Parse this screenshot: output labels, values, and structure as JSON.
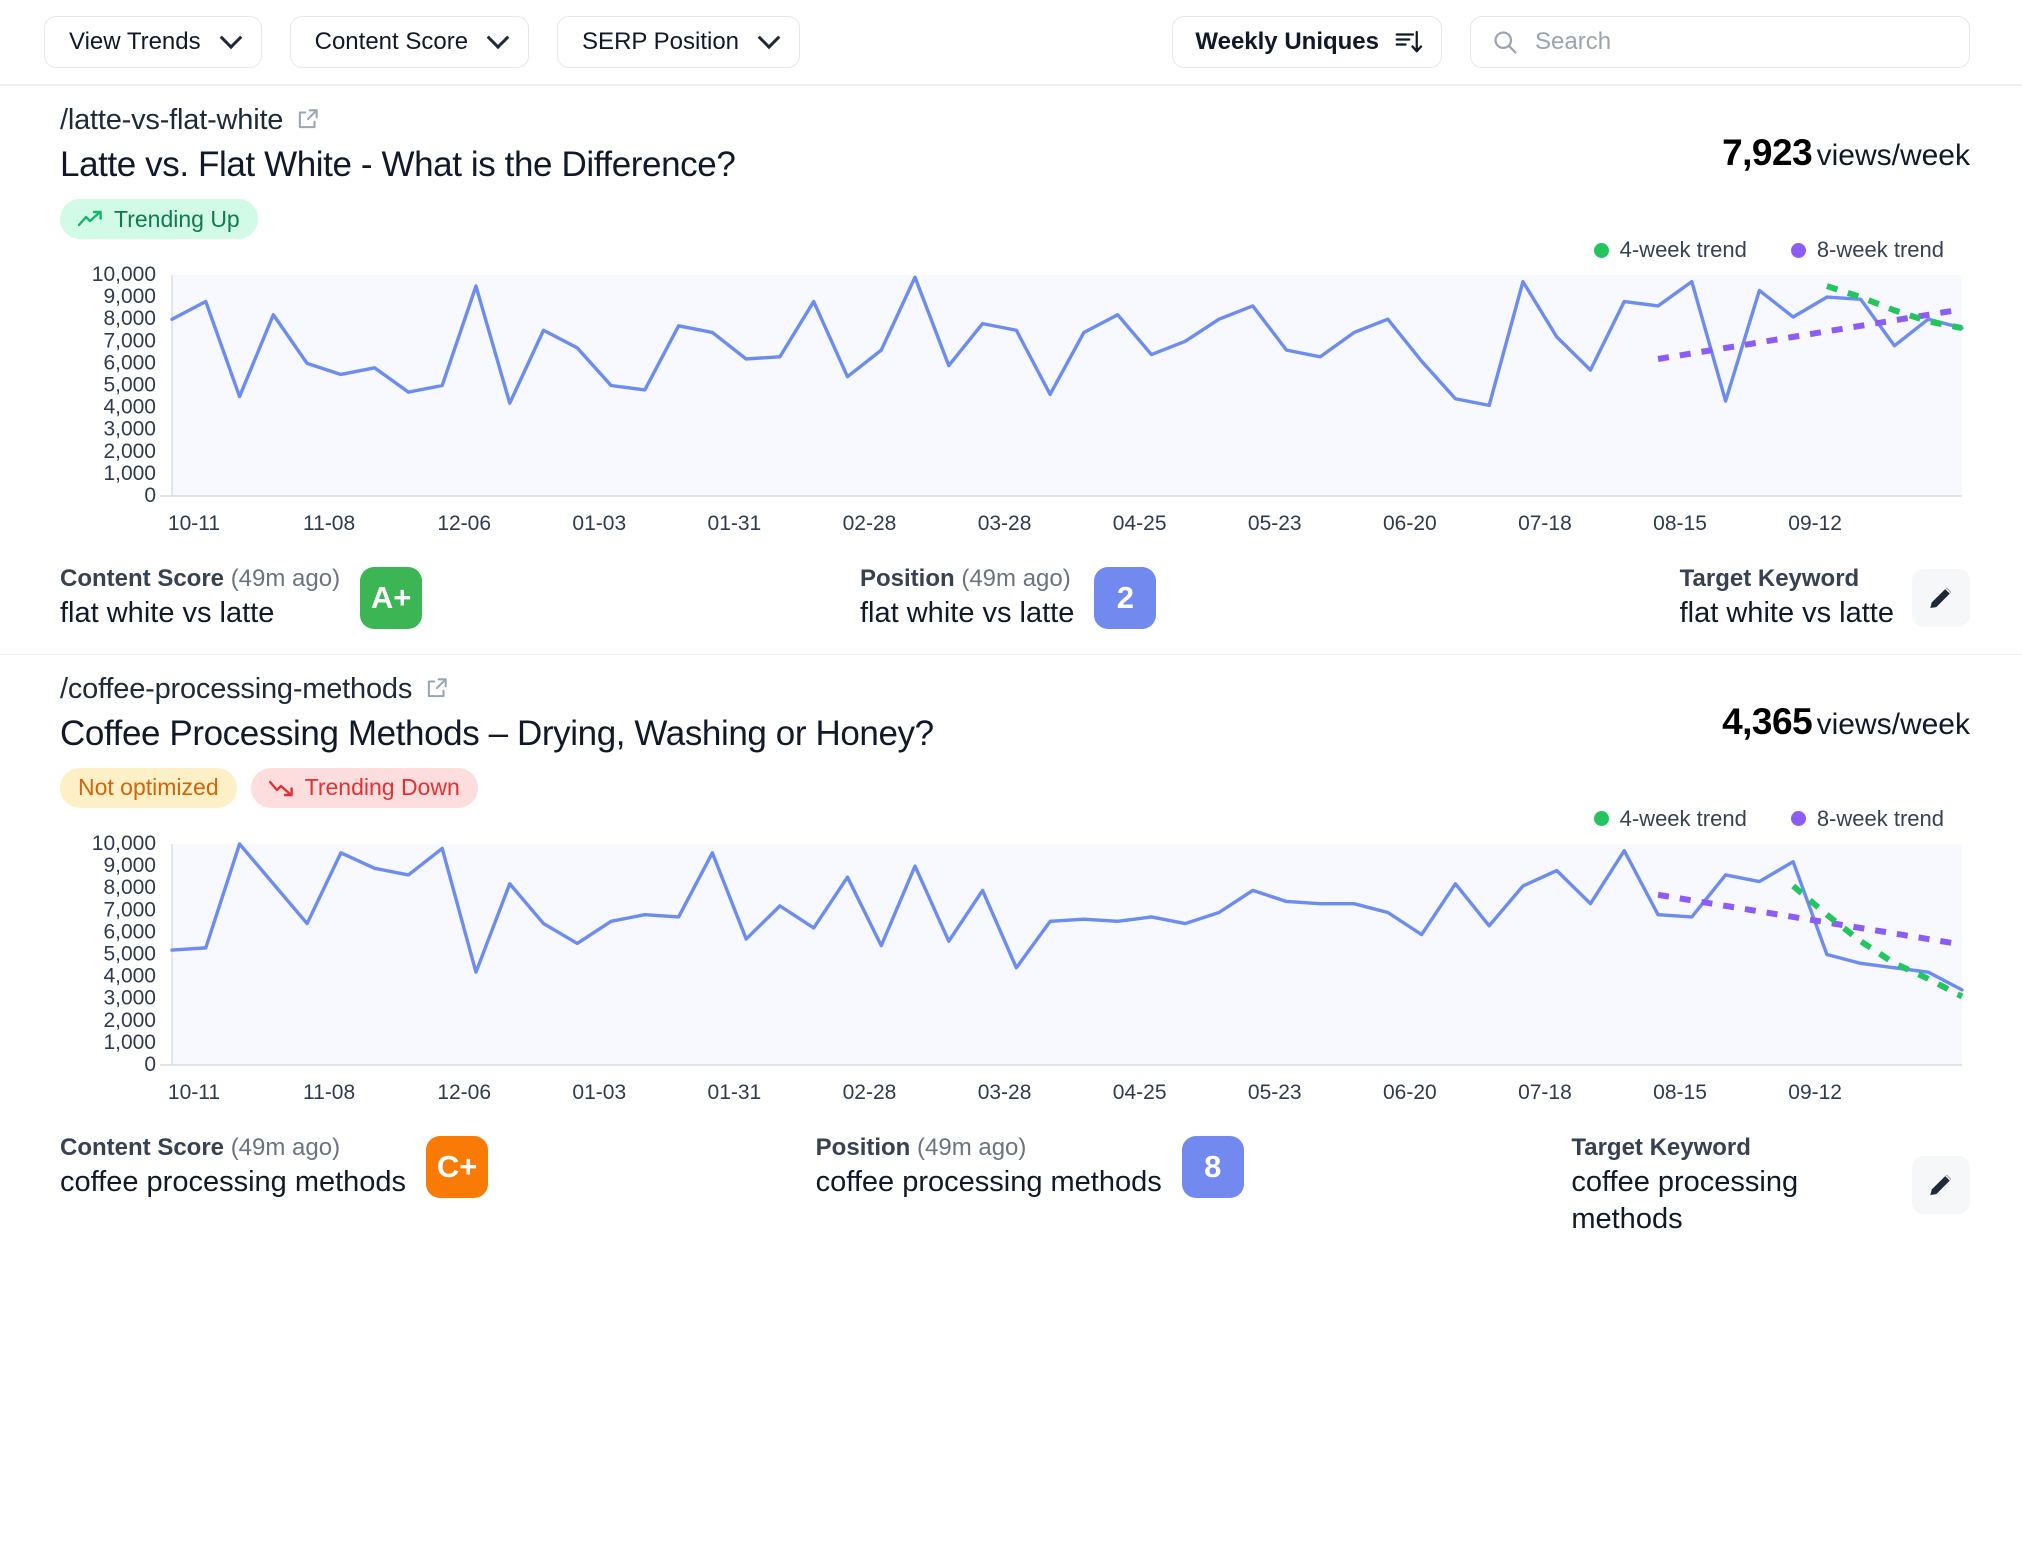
{
  "toolbar": {
    "filters": [
      {
        "label": "View Trends",
        "icon": "chevron-down-icon"
      },
      {
        "label": "Content Score",
        "icon": "chevron-down-icon"
      },
      {
        "label": "SERP Position",
        "icon": "chevron-down-icon"
      }
    ],
    "sort": {
      "label": "Weekly Uniques",
      "icon": "sort-descending-icon"
    },
    "search": {
      "placeholder": "Search",
      "value": "",
      "icon": "search-icon"
    }
  },
  "colors": {
    "line": "#6c8cf0",
    "trend_4week": "#22c55e",
    "trend_8week": "#8b5cf6",
    "chart_fill": "#f7f9ff",
    "score_a_plus": "#3cb554",
    "score_c_plus": "#f97b06",
    "position_chip": "#7289f0"
  },
  "cards": [
    {
      "slug": "/latte-vs-flat-white",
      "title": "Latte vs. Flat White - What is the Difference?",
      "badges": [
        {
          "label": "Trending Up",
          "style": "up",
          "icon": "trend-up-icon"
        }
      ],
      "views_number": "7,923",
      "views_label": "views/week",
      "legend": [
        {
          "label": "4-week trend",
          "color": "#22c55e"
        },
        {
          "label": "8-week trend",
          "color": "#8b5cf6"
        }
      ],
      "metrics": {
        "content_score": {
          "heading": "Content Score",
          "ago": "(49m ago)",
          "keyword": "flat white vs latte",
          "grade": "A+",
          "grade_color": "#3cb554"
        },
        "position": {
          "heading": "Position",
          "ago": "(49m ago)",
          "keyword": "flat white vs latte",
          "value": "2"
        },
        "target_keyword": {
          "heading": "Target Keyword",
          "keyword": "flat white vs latte",
          "edit_icon": "pencil-icon"
        }
      },
      "chart_data": {
        "type": "line",
        "title": "Latte vs. Flat White - What is the Difference?",
        "xlabel": "",
        "ylabel": "Weekly Uniques",
        "ylim": [
          0,
          10000
        ],
        "ytick_values": [
          0,
          1000,
          2000,
          3000,
          4000,
          5000,
          6000,
          7000,
          8000,
          9000,
          10000
        ],
        "ytick_labels": [
          "0",
          "1,000",
          "2,000",
          "3,000",
          "4,000",
          "5,000",
          "6,000",
          "7,000",
          "8,000",
          "9,000",
          "10,000"
        ],
        "xtick_labels": [
          "10-11",
          "11-08",
          "12-06",
          "01-03",
          "01-31",
          "02-28",
          "03-28",
          "04-25",
          "05-23",
          "06-20",
          "07-18",
          "08-15",
          "09-12"
        ],
        "grid": false,
        "legend_position": "top-right",
        "series": [
          {
            "name": "Weekly Uniques",
            "color": "#6c8cf0",
            "style": "solid",
            "values": [
              8000,
              8800,
              4500,
              8200,
              6000,
              5500,
              5800,
              4700,
              5000,
              9500,
              4200,
              7500,
              6700,
              5000,
              4800,
              7700,
              7400,
              6200,
              6300,
              8800,
              5400,
              6600,
              9900,
              5900,
              7800,
              7500,
              4600,
              7400,
              8200,
              6400,
              7000,
              8000,
              8600,
              6600,
              6300,
              7400,
              8000,
              6100,
              4400,
              4100,
              9700,
              7200,
              5700,
              8800,
              8600,
              9700,
              4300,
              9300,
              8100,
              9000,
              8900,
              6800,
              8000,
              7600
            ]
          },
          {
            "name": "8-week trend",
            "color": "#8b5cf6",
            "style": "dashed",
            "start_index": 44,
            "values": [
              6200,
              6450,
              6700,
              6950,
              7200,
              7450,
              7700,
              7950,
              8200,
              8450
            ]
          },
          {
            "name": "4-week trend",
            "color": "#22c55e",
            "style": "dashed",
            "start_index": 49,
            "values": [
              9500,
              9000,
              8400,
              7900,
              7600
            ]
          }
        ]
      }
    },
    {
      "slug": "/coffee-processing-methods",
      "title": "Coffee Processing Methods – Drying, Washing or Honey?",
      "badges": [
        {
          "label": "Not optimized",
          "style": "warn",
          "icon": ""
        },
        {
          "label": "Trending Down",
          "style": "down",
          "icon": "trend-down-icon"
        }
      ],
      "views_number": "4,365",
      "views_label": "views/week",
      "legend": [
        {
          "label": "4-week trend",
          "color": "#22c55e"
        },
        {
          "label": "8-week trend",
          "color": "#8b5cf6"
        }
      ],
      "metrics": {
        "content_score": {
          "heading": "Content Score",
          "ago": "(49m ago)",
          "keyword": "coffee processing methods",
          "grade": "C+",
          "grade_color": "#f97b06"
        },
        "position": {
          "heading": "Position",
          "ago": "(49m ago)",
          "keyword": "coffee processing methods",
          "value": "8"
        },
        "target_keyword": {
          "heading": "Target Keyword",
          "keyword": "coffee processing methods",
          "edit_icon": "pencil-icon"
        }
      },
      "chart_data": {
        "type": "line",
        "title": "Coffee Processing Methods – Drying, Washing or Honey?",
        "xlabel": "",
        "ylabel": "Weekly Uniques",
        "ylim": [
          0,
          10000
        ],
        "ytick_values": [
          0,
          1000,
          2000,
          3000,
          4000,
          5000,
          6000,
          7000,
          8000,
          9000,
          10000
        ],
        "ytick_labels": [
          "0",
          "1,000",
          "2,000",
          "3,000",
          "4,000",
          "5,000",
          "6,000",
          "7,000",
          "8,000",
          "9,000",
          "10,000"
        ],
        "xtick_labels": [
          "10-11",
          "11-08",
          "12-06",
          "01-03",
          "01-31",
          "02-28",
          "03-28",
          "04-25",
          "05-23",
          "06-20",
          "07-18",
          "08-15",
          "09-12"
        ],
        "grid": false,
        "legend_position": "top-right",
        "series": [
          {
            "name": "Weekly Uniques",
            "color": "#6c8cf0",
            "style": "solid",
            "values": [
              5200,
              5300,
              10000,
              8200,
              6400,
              9600,
              8900,
              8600,
              9800,
              4200,
              8200,
              6400,
              5500,
              6500,
              6800,
              6700,
              9600,
              5700,
              7200,
              6200,
              8500,
              5400,
              9000,
              5600,
              7900,
              4400,
              6500,
              6600,
              6500,
              6700,
              6400,
              6900,
              7900,
              7400,
              7300,
              7300,
              6900,
              5900,
              8200,
              6300,
              8100,
              8800,
              7300,
              9700,
              6800,
              6700,
              8600,
              8300,
              9200,
              5000,
              4600,
              4400,
              4200,
              3400
            ]
          },
          {
            "name": "8-week trend",
            "color": "#8b5cf6",
            "style": "dashed",
            "start_index": 44,
            "values": [
              7700,
              7450,
              7200,
              6950,
              6700,
              6450,
              6200,
              5950,
              5700,
              5450
            ]
          },
          {
            "name": "4-week trend",
            "color": "#22c55e",
            "style": "dashed",
            "start_index": 48,
            "values": [
              8100,
              6800,
              5600,
              4600,
              3900,
              3100
            ]
          }
        ]
      }
    }
  ]
}
